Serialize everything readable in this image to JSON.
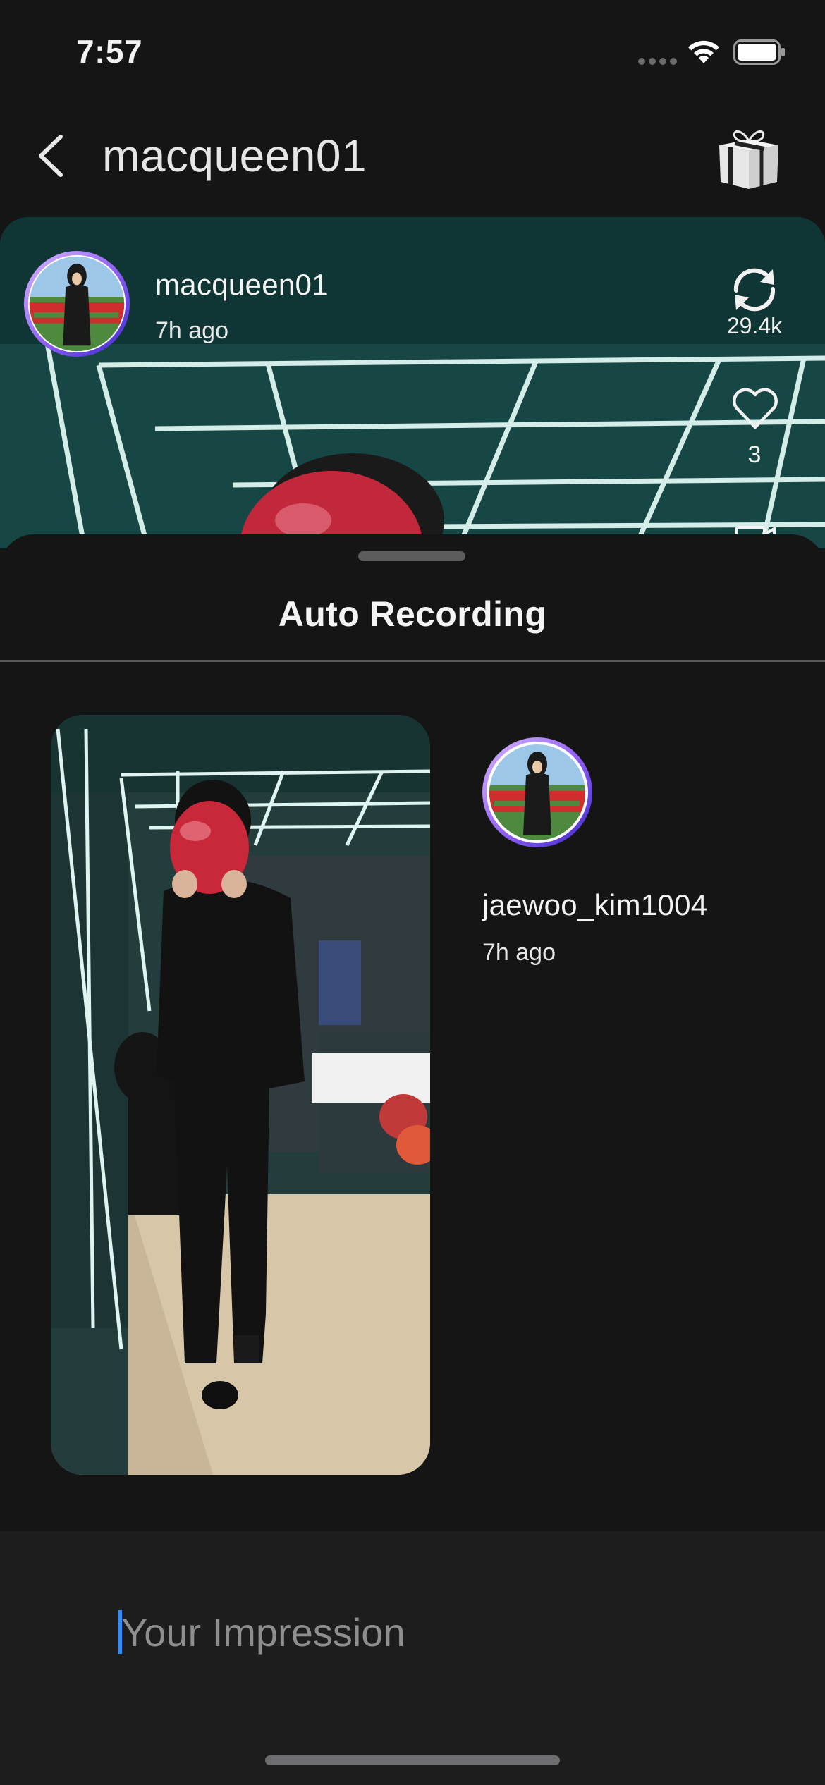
{
  "status_bar": {
    "time": "7:57",
    "icons": [
      "signal-dots-icon",
      "wifi-icon",
      "battery-icon"
    ]
  },
  "nav": {
    "title": "macqueen01",
    "back_icon": "chevron-left-icon",
    "gift_icon": "gift-box-icon"
  },
  "post": {
    "username": "macqueen01",
    "time": "7h ago",
    "repost_count": "29.4k",
    "like_count": "3",
    "actions": [
      "repost-icon",
      "heart-icon",
      "comment-icon"
    ]
  },
  "sheet": {
    "title": "Auto Recording",
    "recording": {
      "username": "jaewoo_kim1004",
      "time": "7h ago"
    }
  },
  "impression": {
    "placeholder": "Your Impression",
    "value": ""
  },
  "colors": {
    "background": "#151516",
    "input_bar": "#1d1d1e",
    "cursor": "#2f8cff",
    "avatar_ring_start": "#c9a8ff",
    "avatar_ring_end": "#4b32d6"
  }
}
